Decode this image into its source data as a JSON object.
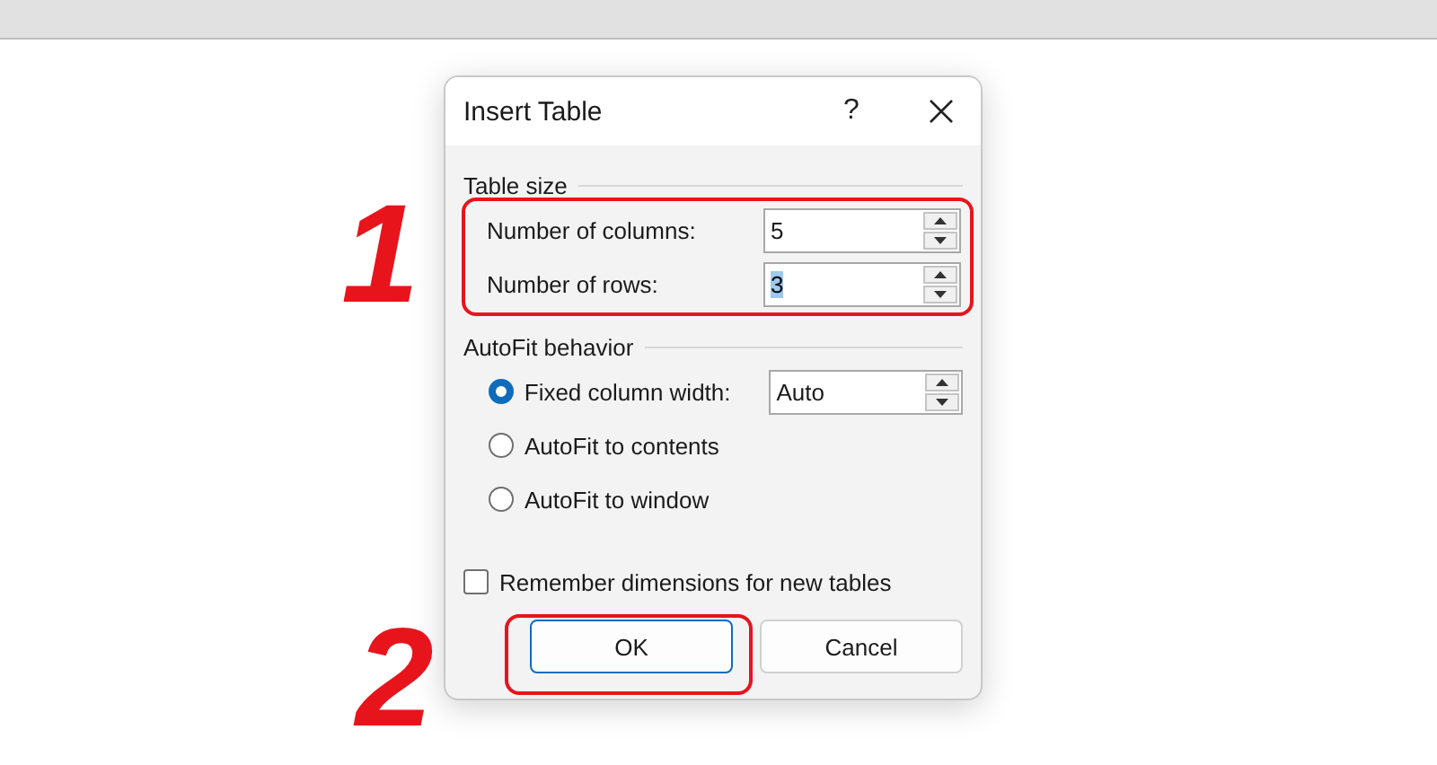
{
  "dialog": {
    "title": "Insert Table",
    "help": "?"
  },
  "table_size": {
    "heading": "Table size",
    "fields": [
      {
        "label": "Number of columns:",
        "value": "5",
        "text_selected": false
      },
      {
        "label": "Number of rows:",
        "value": "3",
        "text_selected": true
      }
    ]
  },
  "autofit": {
    "heading": "AutoFit behavior",
    "options": [
      {
        "label": "Fixed column width:",
        "selected": true,
        "field_value": "Auto"
      },
      {
        "label": "AutoFit to contents",
        "selected": false
      },
      {
        "label": "AutoFit to window",
        "selected": false
      }
    ]
  },
  "remember": {
    "label": "Remember dimensions for new tables",
    "checked": false
  },
  "buttons": [
    {
      "label": "OK",
      "default": true
    },
    {
      "label": "Cancel",
      "default": false
    }
  ],
  "annotations": [
    {
      "label": "1"
    },
    {
      "label": "2"
    }
  ]
}
